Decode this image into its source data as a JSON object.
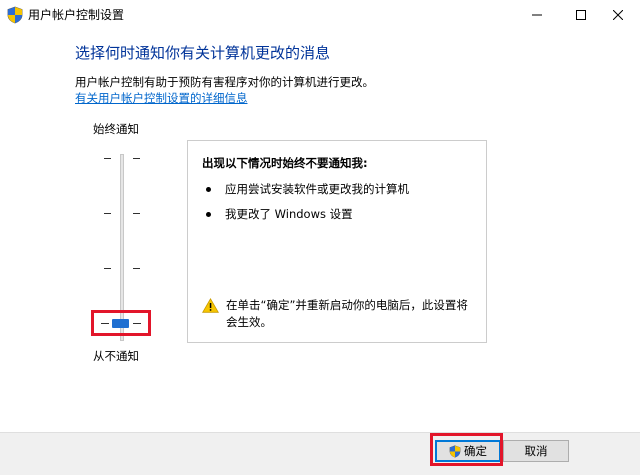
{
  "window": {
    "title": "用户帐户控制设置",
    "icon": "uac-shield-icon",
    "controls": {
      "minimize": "minimize-icon",
      "maximize": "maximize-icon",
      "close": "close-icon"
    }
  },
  "main": {
    "heading": "选择何时通知你有关计算机更改的消息",
    "description": "用户帐户控制有助于预防有害程序对你的计算机进行更改。",
    "link": "有关用户帐户控制设置的详细信息"
  },
  "slider": {
    "top_label": "始终通知",
    "bottom_label": "从不通知",
    "levels": 4,
    "selected_level": 1,
    "thumb_color": "#1f6fd1",
    "highlight_color": "#e2152a"
  },
  "info": {
    "title": "出现以下情况时始终不要通知我:",
    "items": [
      "应用尝试安装软件或更改我的计算机",
      "我更改了 Windows 设置"
    ],
    "warning_icon": "warning-icon",
    "warning": "在单击“确定”并重新启动你的电脑后，此设置将会生效。"
  },
  "footer": {
    "ok_label": "确定",
    "ok_icon": "uac-shield-icon",
    "cancel_label": "取消"
  }
}
